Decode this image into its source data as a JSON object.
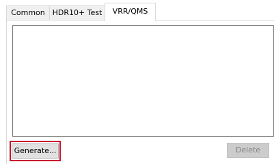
{
  "tabs": [
    {
      "label": "Common",
      "active": false
    },
    {
      "label": "HDR10+ Test",
      "active": false
    },
    {
      "label": "VRR/QMS",
      "active": true
    }
  ],
  "buttons": {
    "generate_label": "Generate...",
    "delete_label": "Delete",
    "delete_enabled": false
  },
  "colors": {
    "highlight": "#c8102e",
    "button_face": "#e1e1e1",
    "disabled_text": "#838383"
  }
}
